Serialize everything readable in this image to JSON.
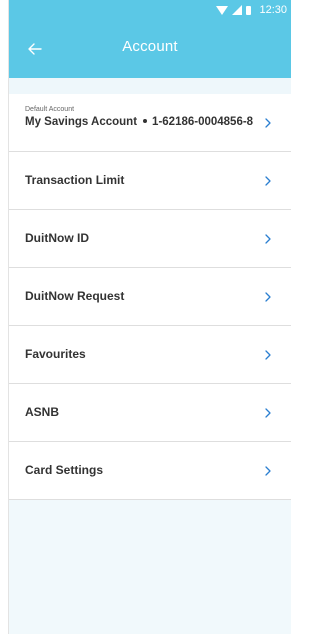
{
  "status_bar": {
    "time": "12:30"
  },
  "header": {
    "title": "Account",
    "back_icon": "arrow-left-icon"
  },
  "default_account": {
    "caption": "Default Account",
    "name": "My Savings Account",
    "number": "1-62186-0004856-8"
  },
  "menu": {
    "items": [
      {
        "label": "Transaction Limit"
      },
      {
        "label": "DuitNow ID"
      },
      {
        "label": "DuitNow Request"
      },
      {
        "label": "Favourites"
      },
      {
        "label": "ASNB"
      },
      {
        "label": "Card Settings"
      }
    ]
  },
  "colors": {
    "primary": "#5bc8e6",
    "chevron": "#2b7fd0",
    "background": "#f1f9fc"
  }
}
